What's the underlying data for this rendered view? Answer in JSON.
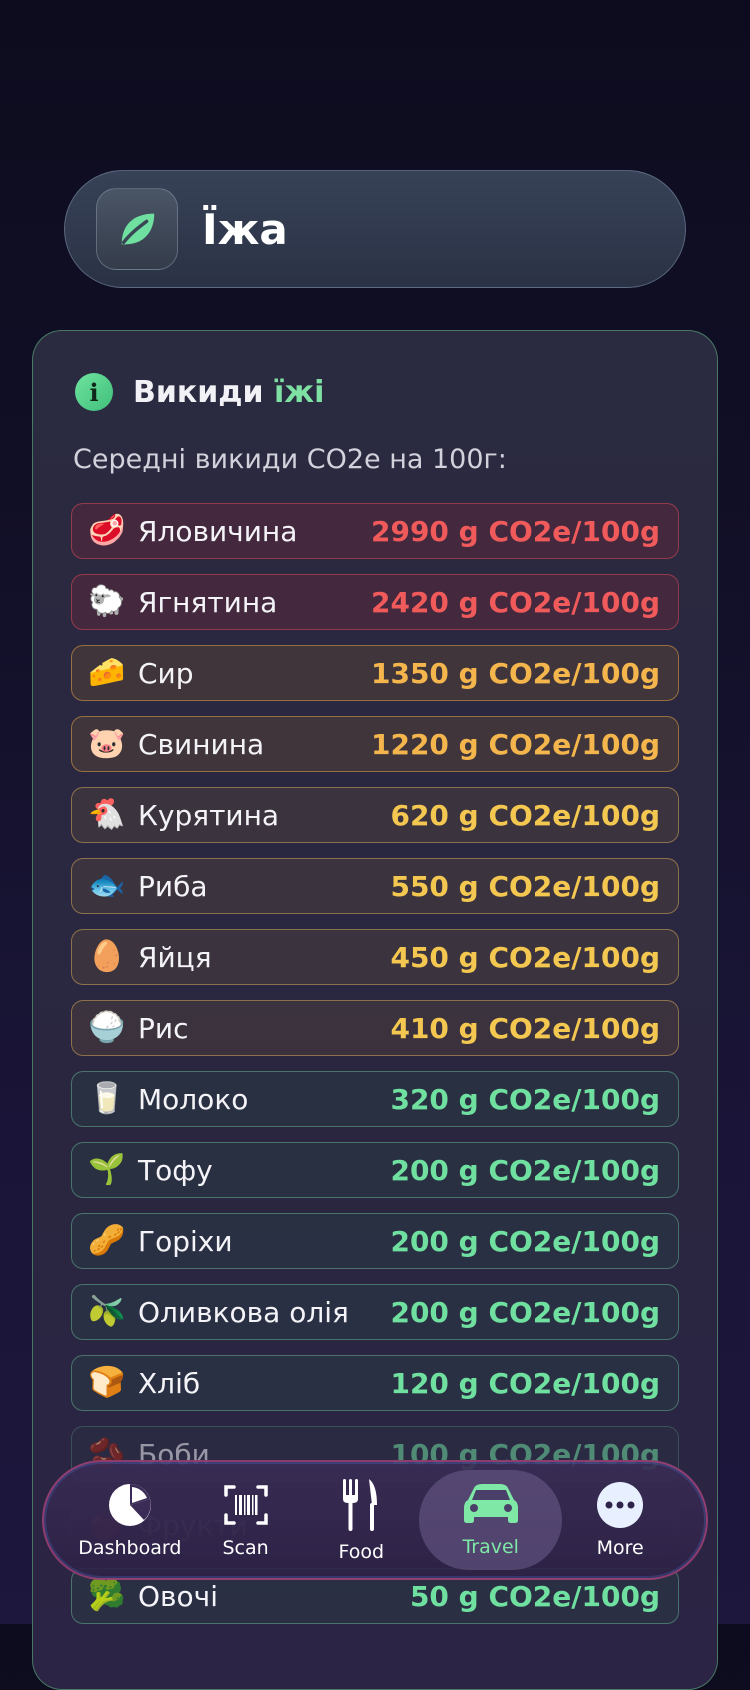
{
  "header": {
    "title": "Їжа",
    "icon": "leaf-icon"
  },
  "card": {
    "title_part1": "Викиди",
    "title_part2": "їжі",
    "subtitle": "Середні викиди CO2e на 100г:",
    "items": [
      {
        "emoji": "🥩",
        "name": "Яловичина",
        "value": "2990 g CO2e/100g",
        "level": "red"
      },
      {
        "emoji": "🐑",
        "name": "Ягнятина",
        "value": "2420 g CO2e/100g",
        "level": "red"
      },
      {
        "emoji": "🧀",
        "name": "Сир",
        "value": "1350 g CO2e/100g",
        "level": "orange"
      },
      {
        "emoji": "🐷",
        "name": "Свинина",
        "value": "1220 g CO2e/100g",
        "level": "orange"
      },
      {
        "emoji": "🐔",
        "name": "Курятина",
        "value": "620 g CO2e/100g",
        "level": "gold"
      },
      {
        "emoji": "🐟",
        "name": "Риба",
        "value": "550 g CO2e/100g",
        "level": "gold"
      },
      {
        "emoji": "🥚",
        "name": "Яйця",
        "value": "450 g CO2e/100g",
        "level": "gold"
      },
      {
        "emoji": "🍚",
        "name": "Рис",
        "value": "410 g CO2e/100g",
        "level": "gold"
      },
      {
        "emoji": "🥛",
        "name": "Молоко",
        "value": "320 g CO2e/100g",
        "level": "green"
      },
      {
        "emoji": "🌱",
        "name": "Тофу",
        "value": "200 g CO2e/100g",
        "level": "green"
      },
      {
        "emoji": "🥜",
        "name": "Горіхи",
        "value": "200 g CO2e/100g",
        "level": "green"
      },
      {
        "emoji": "🫒",
        "name": "Оливкова олія",
        "value": "200 g CO2e/100g",
        "level": "green"
      },
      {
        "emoji": "🍞",
        "name": "Хліб",
        "value": "120 g CO2e/100g",
        "level": "green"
      },
      {
        "emoji": "🫘",
        "name": "Боби",
        "value": "100 g CO2e/100g",
        "level": "green"
      },
      {
        "emoji": "🍎",
        "name": "Фрукти",
        "value": "",
        "level": "green"
      },
      {
        "emoji": "🥦",
        "name": "Овочі",
        "value": "50 g CO2e/100g",
        "level": "green"
      }
    ]
  },
  "tabs": [
    {
      "label": "Dashboard",
      "icon": "pie-chart-icon",
      "active": false
    },
    {
      "label": "Scan",
      "icon": "barcode-scan-icon",
      "active": false
    },
    {
      "label": "Food",
      "icon": "fork-knife-icon",
      "active": false
    },
    {
      "label": "Travel",
      "icon": "car-icon",
      "active": true
    },
    {
      "label": "More",
      "icon": "ellipsis-icon",
      "active": false
    }
  ],
  "colors": {
    "accent_green": "#7fe0a3",
    "high": "#f05a5a",
    "medium": "#f4b64c",
    "low": "#6fe09f"
  }
}
